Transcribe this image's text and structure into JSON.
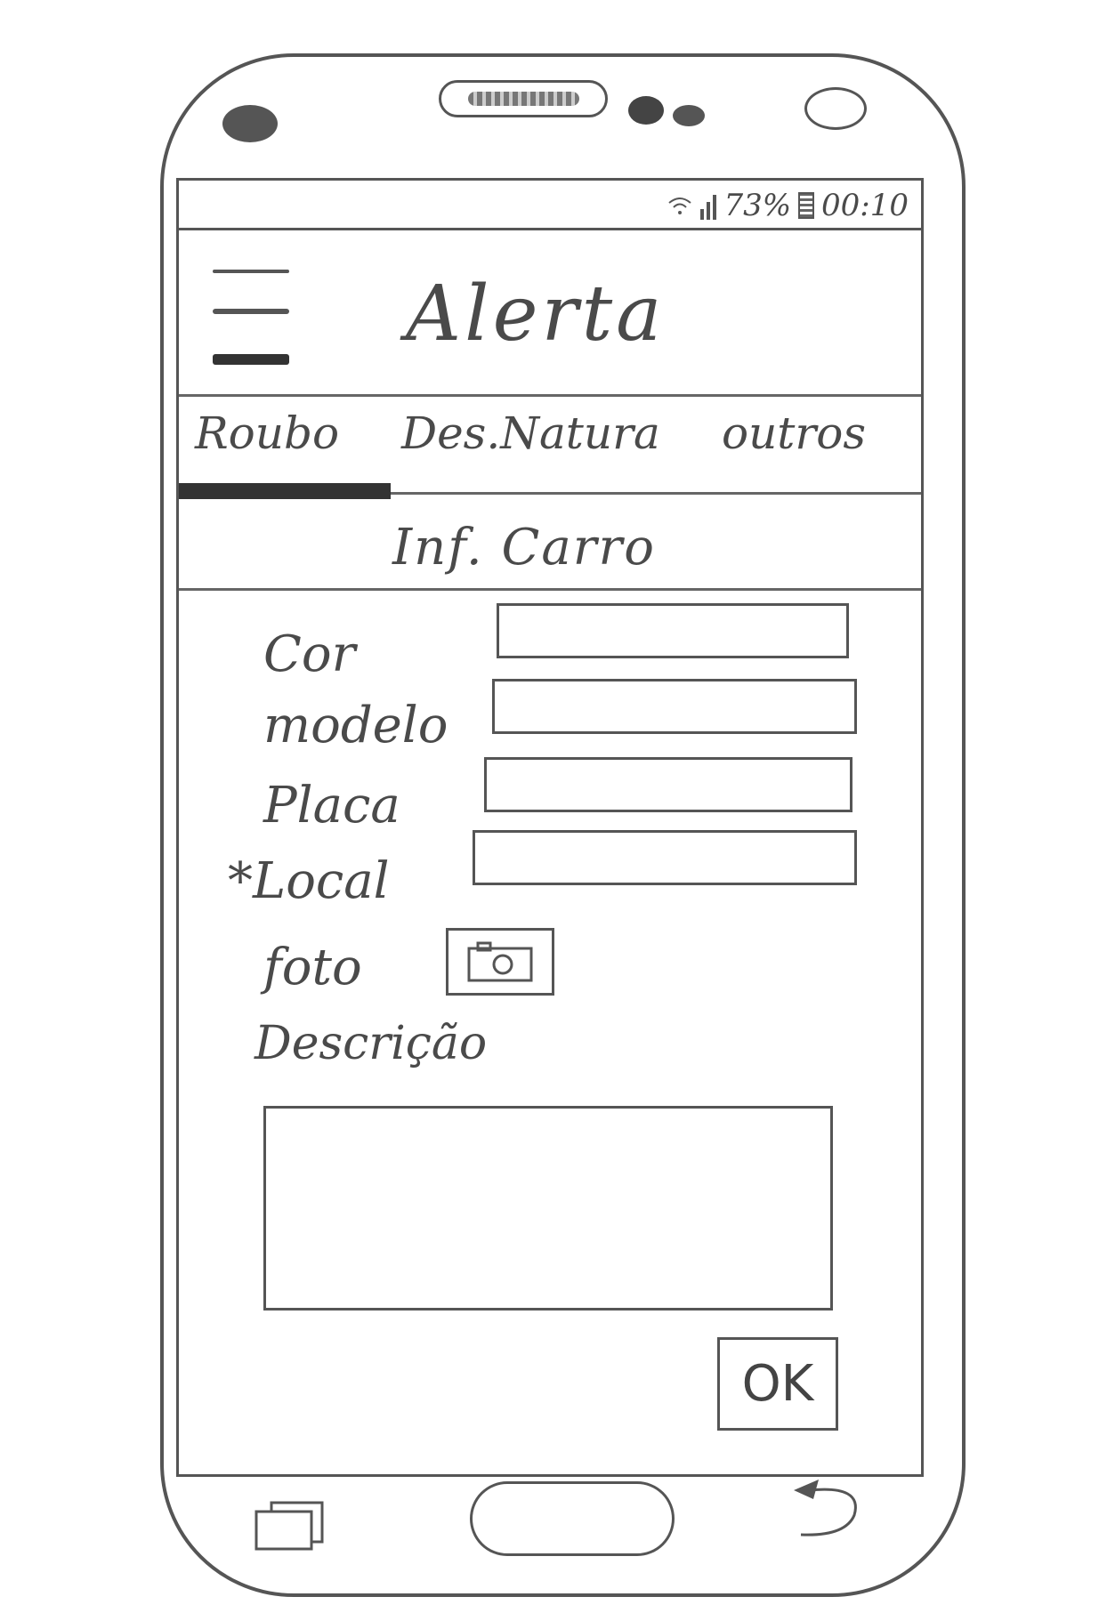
{
  "status_bar": {
    "battery_percent": "73%",
    "time": "00:10"
  },
  "header": {
    "title": "Alerta"
  },
  "tabs": [
    {
      "label": "Roubo",
      "selected": true
    },
    {
      "label": "Des.Natura",
      "selected": false
    },
    {
      "label": "outros",
      "selected": false
    }
  ],
  "section": {
    "title": "Inf. Carro"
  },
  "form": {
    "cor_label": "Cor",
    "modelo_label": "modelo",
    "placa_label": "Placa",
    "local_label": "*Local",
    "foto_label": "foto",
    "descricao_label": "Descrição",
    "cor_value": "",
    "modelo_value": "",
    "placa_value": "",
    "local_value": "",
    "descricao_value": ""
  },
  "actions": {
    "ok_label": "OK"
  },
  "icons": {
    "menu": "hamburger-icon",
    "wifi": "wifi-icon",
    "signal": "signal-icon",
    "battery": "battery-icon",
    "camera": "camera-icon",
    "recent_apps": "recent-apps-icon",
    "home": "home-button",
    "back": "back-icon"
  }
}
